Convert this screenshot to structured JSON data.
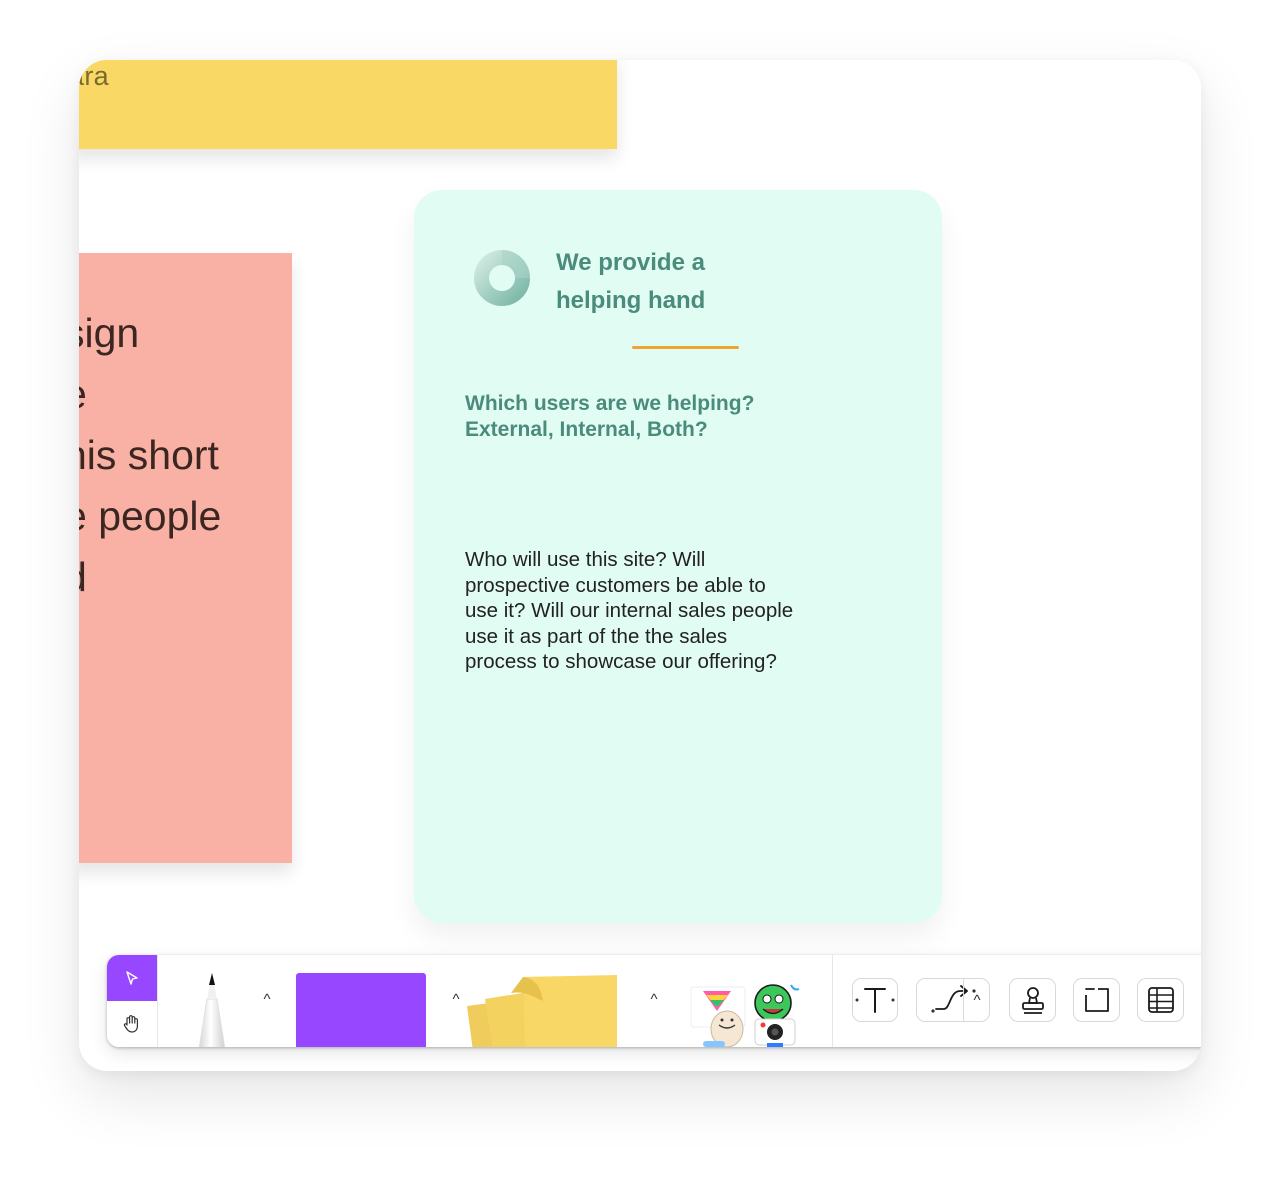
{
  "canvas": {
    "sticky_yellow": {
      "text": "ara"
    },
    "sticky_salmon": {
      "lines": [
        "sign",
        "e",
        "his short",
        "e people",
        "d"
      ]
    },
    "card": {
      "logo_icon": "donut-logo-icon",
      "title_line1": "We provide a",
      "title_line2": "helping hand",
      "question": "Which users are we helping? External, Internal, Both?",
      "body": "Who will use this site? Will prospective customers be able to use it? Will our internal sales people use it as part of the the sales process to showcase our offering?"
    }
  },
  "toolbar": {
    "select_icon": "cursor-icon",
    "hand_icon": "hand-icon",
    "pen_icon": "pen-icon",
    "shape_color": "#9747ff",
    "sticky_icon": "sticky-notes-icon",
    "stickers_icon": "stickers-icon",
    "text_icon": "text-icon",
    "connector_icon": "connector-icon",
    "stamp_icon": "stamp-icon",
    "section_icon": "section-icon",
    "table_icon": "table-icon",
    "expand_caret": "^"
  },
  "colors": {
    "accent": "#9747ff",
    "card_bg": "#e1fcf2",
    "card_text": "#4a8b7b",
    "divider": "#f1a434",
    "sticky_yellow": "#f9d866",
    "sticky_salmon": "#f8b1a4"
  }
}
